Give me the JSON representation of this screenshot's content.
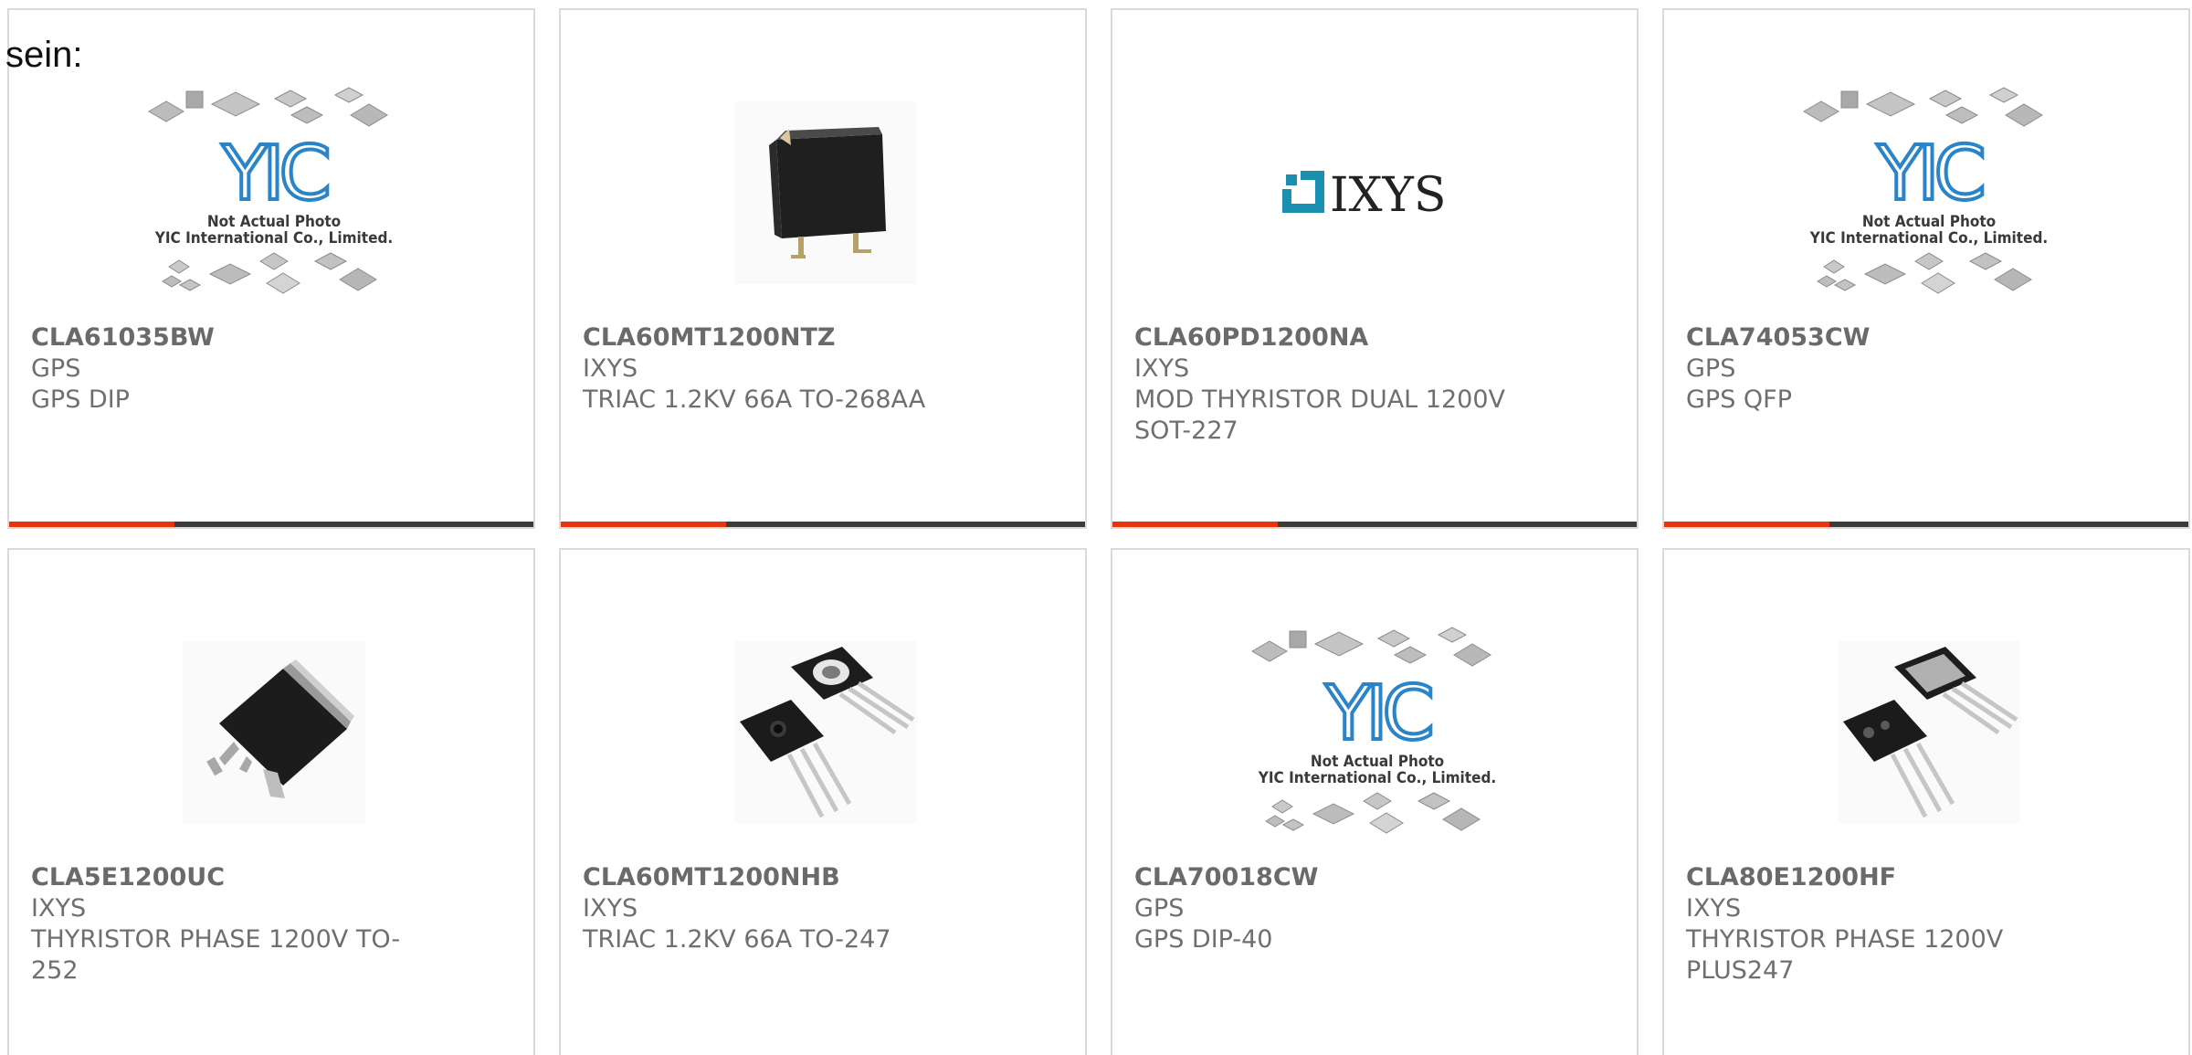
{
  "intro_text": "sein:",
  "products": [
    {
      "part": "CLA61035BW",
      "maker": "GPS",
      "desc": "GPS DIP",
      "image": "yic-placeholder"
    },
    {
      "part": "CLA60MT1200NTZ",
      "maker": "IXYS",
      "desc": "TRIAC 1.2KV 66A TO-268AA",
      "image": "to-268-package"
    },
    {
      "part": "CLA60PD1200NA",
      "maker": "IXYS",
      "desc": "MOD THYRISTOR DUAL 1200V\nSOT-227",
      "image": "ixys-logo"
    },
    {
      "part": "CLA74053CW",
      "maker": "GPS",
      "desc": "GPS QFP",
      "image": "yic-placeholder"
    },
    {
      "part": "CLA5E1200UC",
      "maker": "IXYS",
      "desc": "THYRISTOR PHASE 1200V TO-\n252",
      "image": "to-252-package"
    },
    {
      "part": "CLA60MT1200NHB",
      "maker": "IXYS",
      "desc": "TRIAC 1.2KV 66A TO-247",
      "image": "to-247-package"
    },
    {
      "part": "CLA70018CW",
      "maker": "GPS",
      "desc": "GPS DIP-40",
      "image": "yic-placeholder"
    },
    {
      "part": "CLA80E1200HF",
      "maker": "IXYS",
      "desc": "THYRISTOR PHASE 1200V\nPLUS247",
      "image": "plus247-package"
    }
  ],
  "yic_placeholder": {
    "logo_text": "YIC",
    "line1": "Not Actual Photo",
    "line2": "YIC International Co., Limited."
  },
  "ixys_logo_text": "IXYS",
  "colors": {
    "accent": "#e8340f",
    "bar": "#3c3c3c",
    "border": "#dadada",
    "text": "#6f6f6f",
    "ixys_teal": "#1a8fb0"
  }
}
